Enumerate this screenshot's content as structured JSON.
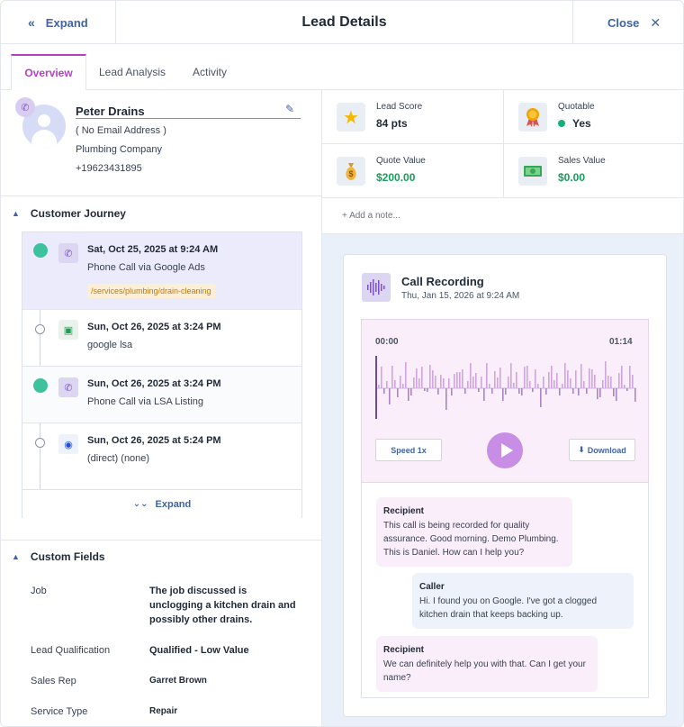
{
  "header": {
    "expand_label": "Expand",
    "title": "Lead Details",
    "close_label": "Close"
  },
  "tabs": [
    {
      "label": "Overview",
      "active": true
    },
    {
      "label": "Lead Analysis",
      "active": false
    },
    {
      "label": "Activity",
      "active": false
    }
  ],
  "contact": {
    "name": "Peter Drains",
    "email": "( No Email Address )",
    "company": "Plumbing Company",
    "phone": "+19623431895"
  },
  "journey": {
    "title": "Customer Journey",
    "expand_label": "Expand",
    "items": [
      {
        "date": "Sat, Oct 25, 2025 at 9:24 AM",
        "source": "Phone Call via Google Ads",
        "path": "/services/plumbing/drain-cleaning",
        "icon": "phone-icon",
        "highlighted": true
      },
      {
        "date": "Sun, Oct 26, 2025 at 3:24 PM",
        "source": "google lsa",
        "icon": "google-business-icon"
      },
      {
        "date": "Sun, Oct 26, 2025 at 3:24 PM",
        "source": "Phone Call via LSA Listing",
        "icon": "phone-icon"
      },
      {
        "date": "Sun, Oct 26, 2025 at 5:24 PM",
        "source": "(direct) (none)",
        "icon": "globe-icon"
      }
    ]
  },
  "custom_fields": {
    "title": "Custom Fields",
    "fields": [
      {
        "label": "Job",
        "value": "The job discussed is unclogging a kitchen drain and possibly other drains."
      },
      {
        "label": "Lead Qualification",
        "value": "Qualified - Low Value"
      },
      {
        "label": "Sales Rep",
        "value": "Garret Brown"
      },
      {
        "label": "Service Type",
        "value": "Repair"
      }
    ]
  },
  "metrics": {
    "lead_score": {
      "label": "Lead Score",
      "value": "84 pts"
    },
    "quotable": {
      "label": "Quotable",
      "value": "Yes"
    },
    "quote_value": {
      "label": "Quote Value",
      "value": "$200.00"
    },
    "sales_value": {
      "label": "Sales Value",
      "value": "$0.00"
    }
  },
  "note": {
    "placeholder": "+ Add a note..."
  },
  "recording": {
    "title": "Call Recording",
    "date": "Thu, Jan 15, 2026 at 9:24 AM",
    "time_start": "00:00",
    "time_end": "01:14",
    "speed_label": "Speed 1x",
    "download_label": "Download",
    "progress": 0
  },
  "transcript": [
    {
      "speaker": "Recipient",
      "text": "This call is being recorded for quality assurance. Good morning. Demo Plumbing. This is Daniel. How can I help you?"
    },
    {
      "speaker": "Caller",
      "text": "Hi. I found you on Google. I've got a clogged kitchen drain that keeps backing up."
    },
    {
      "speaker": "Recipient",
      "text": "We can definitely help you with that. Can I get your name?"
    }
  ],
  "colors": {
    "accent": "#b640c4",
    "link": "#3f63a8",
    "success": "#13a15a",
    "timeline_dot": "#3cc39e"
  }
}
